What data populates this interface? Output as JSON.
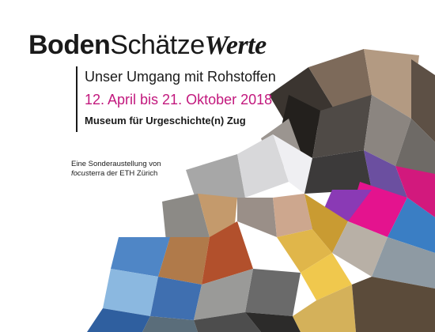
{
  "title": {
    "part1": "Boden",
    "part2": "Schätze",
    "part3": "Werte"
  },
  "subtitle": "Unser Umgang mit Rohstoffen",
  "dates": "12. April bis 21. Oktober 2018",
  "museum": "Museum für Urgeschichte(n) Zug",
  "credit": {
    "line1": "Eine Sonderaustellung von",
    "brand": "focus",
    "line2_rest": "terra der ETH Zürich"
  },
  "colors": {
    "accent": "#c2187d",
    "text": "#1a1a1a",
    "background": "#ffffff"
  }
}
